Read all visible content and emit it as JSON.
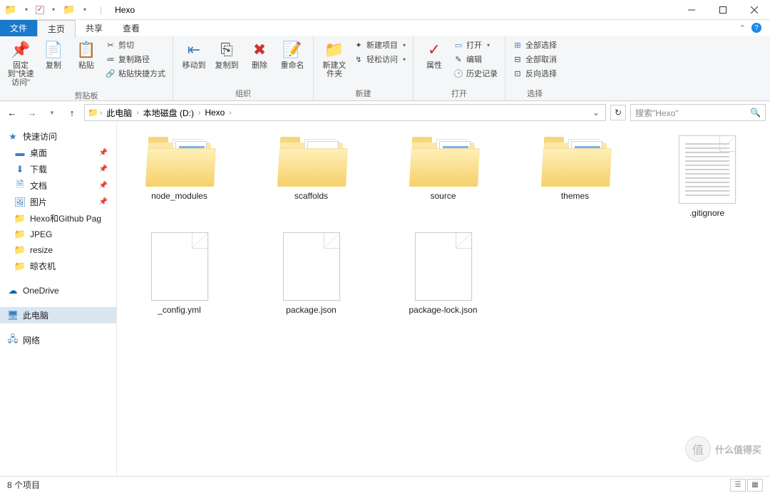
{
  "window": {
    "title": "Hexo"
  },
  "tabs": {
    "file": "文件",
    "home": "主页",
    "share": "共享",
    "view": "查看"
  },
  "ribbon": {
    "clipboard": {
      "label": "剪贴板",
      "pin": "固定到\"快速访问\"",
      "copy": "复制",
      "paste": "粘贴",
      "cut": "剪切",
      "copy_path": "复制路径",
      "paste_shortcut": "粘贴快捷方式"
    },
    "organize": {
      "label": "组织",
      "move_to": "移动到",
      "copy_to": "复制到",
      "delete": "删除",
      "rename": "重命名"
    },
    "new": {
      "label": "新建",
      "new_folder": "新建文件夹",
      "new_item": "新建项目",
      "easy_access": "轻松访问"
    },
    "open": {
      "label": "打开",
      "properties": "属性",
      "open": "打开",
      "edit": "编辑",
      "history": "历史记录"
    },
    "select": {
      "label": "选择",
      "select_all": "全部选择",
      "select_none": "全部取消",
      "invert": "反向选择"
    }
  },
  "breadcrumbs": {
    "pc": "此电脑",
    "drive": "本地磁盘 (D:)",
    "folder": "Hexo"
  },
  "search": {
    "placeholder": "搜索\"Hexo\""
  },
  "sidebar": {
    "quick_access": "快速访问",
    "desktop": "桌面",
    "downloads": "下载",
    "documents": "文档",
    "pictures": "图片",
    "hexo_github": "Hexo和Github Pag",
    "jpeg": "JPEG",
    "resize": "resize",
    "dryer": "晾衣机",
    "onedrive": "OneDrive",
    "this_pc": "此电脑",
    "network": "网络"
  },
  "files": {
    "node_modules": "node_modules",
    "scaffolds": "scaffolds",
    "source": "source",
    "themes": "themes",
    "gitignore": ".gitignore",
    "config": "_config.yml",
    "package": "package.json",
    "package_lock": "package-lock.json"
  },
  "status": {
    "count": "8 个项目"
  },
  "watermark": {
    "text": "什么值得买",
    "badge": "值"
  }
}
